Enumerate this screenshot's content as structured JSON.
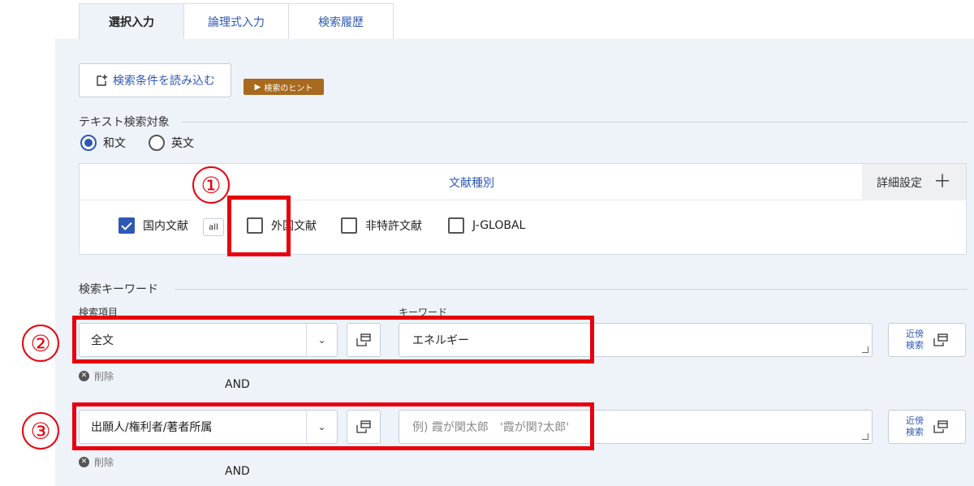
{
  "tabs": [
    {
      "label": "選択入力",
      "active": true
    },
    {
      "label": "論理式入力",
      "active": false
    },
    {
      "label": "検索履歴",
      "active": false
    }
  ],
  "load_button": {
    "label": "検索条件を読み込む",
    "icon": "load-icon"
  },
  "hint_badge": {
    "label": "検索のヒント"
  },
  "text_target": {
    "title": "テキスト検索対象",
    "options": [
      {
        "label": "和文",
        "selected": true
      },
      {
        "label": "英文",
        "selected": false
      }
    ]
  },
  "doc_types": {
    "title": "文献種別",
    "detail_label": "詳細設定",
    "all_label": "all",
    "items": [
      {
        "label": "国内文献",
        "checked": true
      },
      {
        "label": "外国文献",
        "checked": false
      },
      {
        "label": "非特許文献",
        "checked": false
      },
      {
        "label": "J-GLOBAL",
        "checked": false
      }
    ]
  },
  "keyword_section": {
    "title": "検索キーワード",
    "field_label": "検索項目",
    "keyword_label": "キーワード",
    "rows": [
      {
        "field": "全文",
        "keyword": "エネルギー",
        "placeholder": "",
        "delete_label": "削除",
        "near_label_1": "近傍",
        "near_label_2": "検索",
        "op": "AND"
      },
      {
        "field": "出願人/権利者/著者所属",
        "keyword": "",
        "placeholder": "例) 霞が関太郎　'霞が関?太郎'",
        "delete_label": "削除",
        "near_label_1": "近傍",
        "near_label_2": "検索",
        "op": "AND"
      }
    ]
  },
  "annotations": {
    "one": "①",
    "two": "②",
    "three": "③",
    "color": "#e8000c"
  },
  "colors": {
    "accent": "#2e58b4",
    "panel": "#edf3f9",
    "hint": "#a86a1e"
  }
}
